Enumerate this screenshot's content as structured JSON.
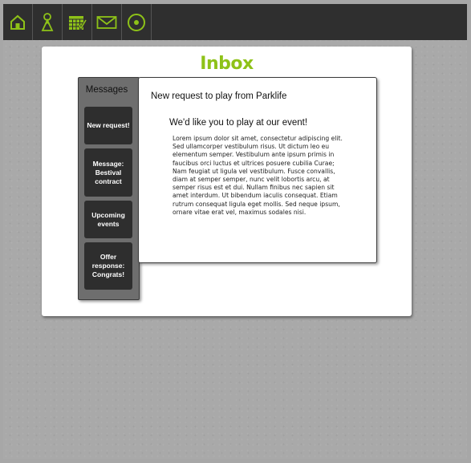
{
  "nav": {
    "items": [
      {
        "icon": "home-icon"
      },
      {
        "icon": "person-icon"
      },
      {
        "icon": "calendar-icon"
      },
      {
        "icon": "mail-icon"
      },
      {
        "icon": "record-icon"
      }
    ],
    "icon_color": "#8ec218"
  },
  "card": {
    "title": "Inbox",
    "title_color": "#8ec218"
  },
  "sidebar": {
    "title": "Messages",
    "items": [
      {
        "label": "New request!"
      },
      {
        "label": "Message: Bestival contract"
      },
      {
        "label": "Upcoming events"
      },
      {
        "label": "Offer response: Congrats!"
      }
    ]
  },
  "message": {
    "heading": "New request to play from Parklife",
    "subheading": "We'd like you to play at our event!",
    "body": "Lorem ipsum dolor sit amet, consectetur adipiscing elit. Sed ullamcorper vestibulum risus. Ut dictum leo eu elementum semper. Vestibulum ante ipsum primis in faucibus orci luctus et ultrices posuere cubilia Curae; Nam feugiat ut ligula vel vestibulum. Fusce convallis, diam at semper semper, nunc velit lobortis arcu, at semper risus est et dui. Nullam finibus nec sapien sit amet interdum. Ut bibendum iaculis consequat. Etiam rutrum consequat ligula eget mollis. Sed neque ipsum, ornare vitae erat vel, maximus sodales nisi."
  }
}
